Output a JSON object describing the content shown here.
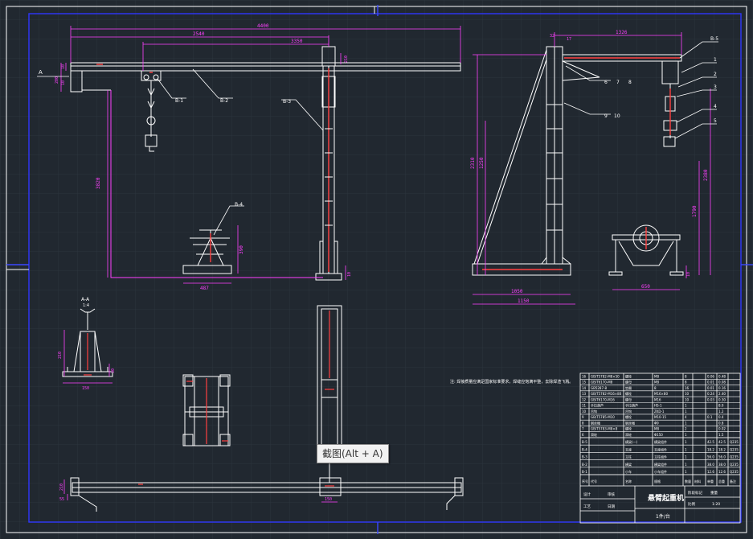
{
  "colors": {
    "background": "#212830",
    "grid": "#2c343d",
    "frame": "#2e36ff",
    "line": "#ffffff",
    "dimension": "#ff40ff",
    "accent": "#ff4040",
    "crosshair": "#3a48ff"
  },
  "view_A": {
    "section_marker": "A",
    "dims": {
      "overall": "4400",
      "span1": "2540",
      "span2": "3350",
      "height": "3820",
      "base": "487",
      "stand_h": "390",
      "small1": "10",
      "small2": "200",
      "small3": "10",
      "small4": "210",
      "foot": "10"
    },
    "callouts": [
      "B-1",
      "B-2",
      "B-3",
      "B-4"
    ]
  },
  "view_side": {
    "dims": {
      "arm": "1326",
      "top1": "32",
      "top2": "17",
      "height1": "2310",
      "height2": "1250",
      "height3": "2380",
      "height4": "1790",
      "base_w": "1050",
      "base_total": "1150",
      "cart_w": "650",
      "cart_h": "10"
    },
    "callouts": [
      "B-5",
      "6",
      "7",
      "8",
      "9",
      "10",
      "1",
      "2",
      "3",
      "4",
      "5"
    ]
  },
  "view_AA": {
    "title": "A-A",
    "scale": "1:4",
    "dims": {
      "height": "210",
      "base": "150",
      "side": "30"
    }
  },
  "view_plan": {
    "dims": {
      "left_h": "210",
      "left_w": "55",
      "mid": "150"
    }
  },
  "note": "注: 焊接质量应满足国家标准要求，焊缝应饱满平整，去除焊渣飞溅。",
  "bom": {
    "rows": [
      [
        "16",
        "GB/T5782-M8×50",
        "螺栓",
        "M8",
        "8",
        "",
        "0.06",
        "0.48",
        ""
      ],
      [
        "15",
        "GB/T6170-M8",
        "螺母",
        "M8",
        "8",
        "",
        "0.01",
        "0.08",
        ""
      ],
      [
        "14",
        "GB5287-8",
        "垫圈",
        "8",
        "16",
        "",
        "0.01",
        "0.16",
        ""
      ],
      [
        "13",
        "GB/T5782-M16×80",
        "螺栓",
        "M16×80",
        "10",
        "",
        "0.24",
        "2.40",
        ""
      ],
      [
        "12",
        "GB/T6170-M16",
        "螺母",
        "M16",
        "10",
        "",
        "0.03",
        "0.30",
        ""
      ],
      [
        "11",
        "手拉葫芦",
        "手拉葫芦",
        "HS-1",
        "1",
        "",
        "",
        "8.0",
        ""
      ],
      [
        "10",
        "吊钩",
        "吊钩",
        "ZKD-1",
        "1",
        "",
        "",
        "1.2",
        ""
      ],
      [
        "9",
        "GB/T5785-M10",
        "螺栓",
        "M10-15",
        "4",
        "",
        "0.1",
        "0.4",
        ""
      ],
      [
        "8",
        "钢丝绳",
        "钢丝绳",
        "Φ9",
        "1",
        "",
        "",
        "0.8",
        ""
      ],
      [
        "7",
        "GB/T5783-M8×8",
        "螺栓",
        "M8",
        "2",
        "",
        "",
        "0.02",
        ""
      ],
      [
        "6",
        "滑轮",
        "滑轮",
        "Φ150",
        "1",
        "",
        "",
        "1.5",
        ""
      ]
    ],
    "rows2": [
      [
        "B-5",
        "横梁(一)",
        "横梁组件",
        "1",
        "",
        "42.5",
        "42.5",
        "Q235"
      ],
      [
        "B-4",
        "支座",
        "支座组件",
        "1",
        "",
        "18.2",
        "18.2",
        "Q235"
      ],
      [
        "B-3",
        "立柱",
        "立柱组件",
        "1",
        "",
        "56.0",
        "56.0",
        "Q235"
      ],
      [
        "B-2",
        "横梁",
        "横梁组件",
        "1",
        "",
        "38.0",
        "38.0",
        "Q235"
      ],
      [
        "B-1",
        "小车",
        "小车组件",
        "1",
        "",
        "12.6",
        "12.6",
        "Q235"
      ]
    ],
    "headers": [
      "序号",
      "代号",
      "名称",
      "规格",
      "数量",
      "材料",
      "单重",
      "总重",
      "备注"
    ]
  },
  "title_block": {
    "drawing_title": "悬臂起重机",
    "sub_title": "1件/台",
    "labels": [
      "设计",
      "审核",
      "工艺",
      "日期"
    ],
    "meta": [
      "阶段标记",
      "重量",
      "比例",
      "1:20"
    ]
  },
  "tooltip": "截图(Alt + A)"
}
